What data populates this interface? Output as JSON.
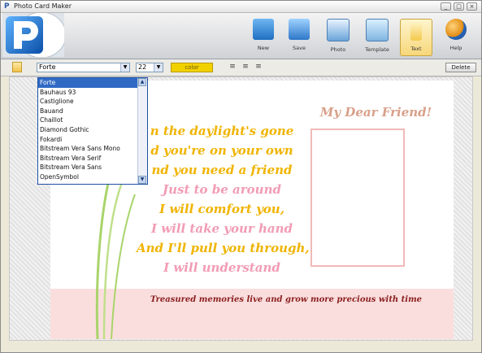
{
  "window": {
    "title": "Photo Card Maker",
    "app_icon": "P"
  },
  "window_controls": [
    "minimize",
    "maximize",
    "close"
  ],
  "toolbar": {
    "items": [
      {
        "label": "New",
        "icon": "folder-icon"
      },
      {
        "label": "Save",
        "icon": "save-icon"
      },
      {
        "label": "Photo",
        "icon": "photo-icon"
      },
      {
        "label": "Template",
        "icon": "template-icon"
      },
      {
        "label": "Text",
        "icon": "text-icon",
        "active": true
      },
      {
        "label": "Help",
        "icon": "help-globe-icon"
      }
    ]
  },
  "format_bar": {
    "font_value": "Forte",
    "size_value": "22",
    "color_label": "color",
    "delete_label": "Delete",
    "color_swatch": "#f2d100"
  },
  "font_dropdown": {
    "options": [
      "Forte",
      "Bauhaus 93",
      "Castiglione",
      "Bauand",
      "Chaillot",
      "Diamond Gothic",
      "Fokardi",
      "Bitstream Vera Sans Mono",
      "Bitstream Vera Serif",
      "Bitstream Vera Sans",
      "OpenSymbol"
    ],
    "selected_index": 0
  },
  "card": {
    "greeting": "My Dear Friend!",
    "poem_lines": [
      {
        "text": "n the daylight's gone",
        "color": "#f0b400"
      },
      {
        "text": "d you're on your own",
        "color": "#f0b400"
      },
      {
        "text": "nd you need a friend",
        "color": "#f0b400"
      },
      {
        "text": "Just to be around",
        "color": "#f29bb5"
      },
      {
        "text": "I will comfort you,",
        "color": "#f0b400"
      },
      {
        "text": "I will take your hand",
        "color": "#f29bb5"
      },
      {
        "text": "And I'll pull you through,",
        "color": "#f0b400"
      },
      {
        "text": "I will understand",
        "color": "#f29bb5"
      }
    ],
    "bottom_text": "Treasured memories live and grow more precious with time"
  }
}
